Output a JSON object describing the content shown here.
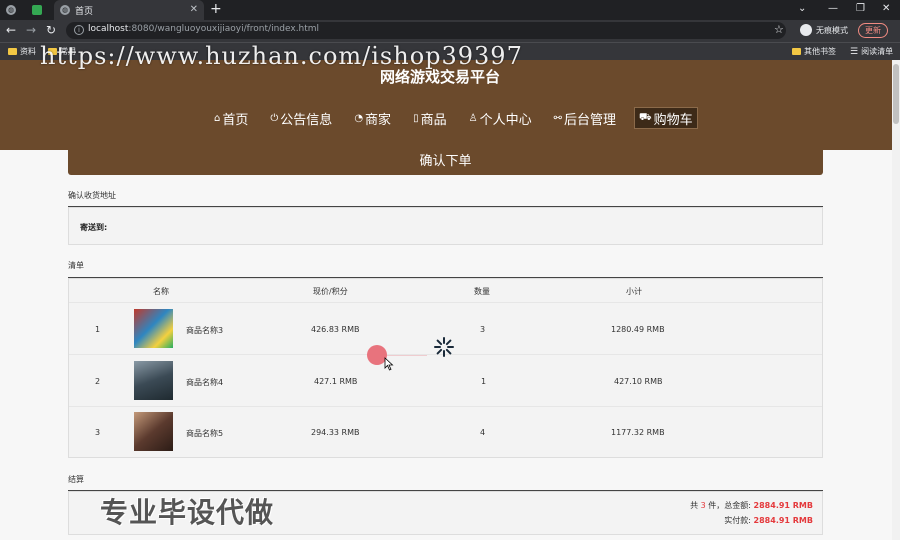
{
  "browser": {
    "tabs": [
      {
        "label": ""
      },
      {
        "label": ""
      },
      {
        "label": "首页"
      }
    ],
    "url_host": "localhost",
    "url_rest": ":8080/wangluoyouxijiaoyi/front/index.html",
    "incognito_label": "无痕模式",
    "update_label": "更新",
    "bookmarks": [
      {
        "label": "资料"
      },
      {
        "label": "常用"
      },
      {
        "label": "其他书签"
      },
      {
        "label": "阅读清单"
      }
    ]
  },
  "overlay": {
    "url_watermark": "https://www.huzhan.com/ishop39397",
    "bottom_watermark": "专业毕设代做"
  },
  "site": {
    "title": "网络游戏交易平台",
    "nav": [
      {
        "label": "首页",
        "icon": "home-icon",
        "glyph": "⌂"
      },
      {
        "label": "公告信息",
        "icon": "power-icon",
        "glyph": "⏻"
      },
      {
        "label": "商家",
        "icon": "dashboard-icon",
        "glyph": "◔"
      },
      {
        "label": "商品",
        "icon": "book-icon",
        "glyph": "▯"
      },
      {
        "label": "个人中心",
        "icon": "user-icon",
        "glyph": "♙"
      },
      {
        "label": "后台管理",
        "icon": "link-icon",
        "glyph": "⚯"
      },
      {
        "label": "购物车",
        "icon": "cart-icon",
        "glyph": "⛟"
      }
    ]
  },
  "order": {
    "confirm_title": "确认下单",
    "address_section": "确认收货地址",
    "ship_to_label": "寄送到:",
    "list_section": "清单",
    "columns": {
      "name": "名称",
      "price": "现价/积分",
      "qty": "数量",
      "subtotal": "小计"
    },
    "items": [
      {
        "index": "1",
        "name": "商品名称3",
        "price": "426.83 RMB",
        "qty": "3",
        "subtotal": "1280.49 RMB",
        "thumb_colors": [
          "#c0392b",
          "#2e86c1",
          "#f4d03f"
        ]
      },
      {
        "index": "2",
        "name": "商品名称4",
        "price": "427.1 RMB",
        "qty": "1",
        "subtotal": "427.10 RMB",
        "thumb_colors": [
          "#3b4a55",
          "#8a9aa6",
          "#1f2a30"
        ]
      },
      {
        "index": "3",
        "name": "商品名称5",
        "price": "294.33 RMB",
        "qty": "4",
        "subtotal": "1177.32 RMB",
        "thumb_colors": [
          "#5b3a2e",
          "#c49a7a",
          "#2c1c16"
        ]
      }
    ],
    "checkout_section": "结算",
    "total_prefix": "共",
    "total_count": "3",
    "total_mid": "件，总金额:",
    "total_amount": "2884.91 RMB",
    "paid_label": "实付款:",
    "paid_amount": "2884.91 RMB"
  }
}
